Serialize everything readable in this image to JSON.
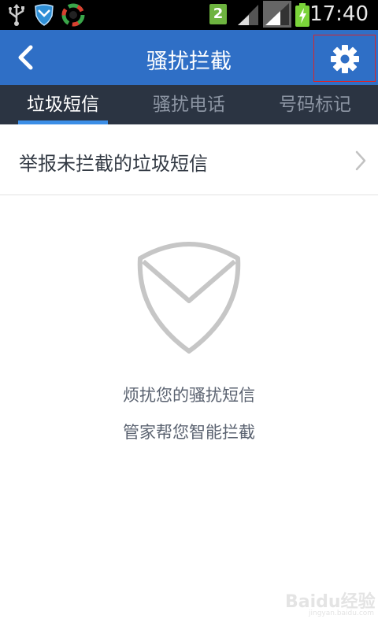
{
  "status_bar": {
    "time": "17:40",
    "sim_badge": "2",
    "icons": [
      "usb-icon",
      "shield-app-icon",
      "sync-app-icon",
      "signal-icon",
      "signal-icon-2",
      "battery-charging-icon"
    ]
  },
  "header": {
    "title": "骚扰拦截",
    "back_icon": "chevron-left-icon",
    "settings_icon": "gear-icon"
  },
  "tabs": [
    {
      "label": "垃圾短信",
      "active": true
    },
    {
      "label": "骚扰电话",
      "active": false
    },
    {
      "label": "号码标记",
      "active": false
    }
  ],
  "report_row": {
    "label": "举报未拦截的垃圾短信"
  },
  "empty_state": {
    "icon": "envelope-shield-icon",
    "line1": "烦扰您的骚扰短信",
    "line2": "管家帮您智能拦截"
  },
  "watermark": {
    "text": "Baidu经验",
    "sub": "jingyan.baidu.com"
  },
  "colors": {
    "header_blue": "#2f6fc6",
    "tab_bar": "#2b3442",
    "tab_indicator": "#3c8ee6",
    "highlight_box": "#d9262b"
  }
}
